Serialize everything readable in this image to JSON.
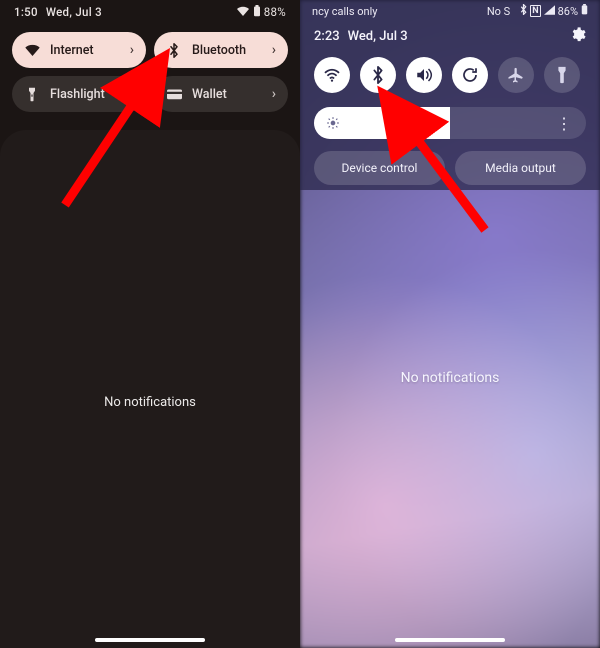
{
  "left": {
    "status": {
      "time": "1:50",
      "date": "Wed, Jul 3",
      "battery_percent": "88%"
    },
    "tiles": [
      {
        "id": "internet",
        "label": "Internet",
        "state": "on",
        "icon": "wifi-icon"
      },
      {
        "id": "bluetooth",
        "label": "Bluetooth",
        "state": "on",
        "icon": "bluetooth-icon"
      },
      {
        "id": "flashlight",
        "label": "Flashlight",
        "state": "off",
        "icon": "flashlight-icon"
      },
      {
        "id": "wallet",
        "label": "Wallet",
        "state": "off",
        "icon": "wallet-icon"
      }
    ],
    "no_notifications": "No notifications"
  },
  "right": {
    "status": {
      "left_text": "ncy calls only",
      "carrier_right_partial": "No S",
      "battery_percent": "86%"
    },
    "header": {
      "time": "2:23",
      "date": "Wed, Jul 3"
    },
    "toggles": [
      {
        "id": "wifi",
        "state": "on",
        "icon": "wifi-icon"
      },
      {
        "id": "bluetooth",
        "state": "on",
        "icon": "bluetooth-icon"
      },
      {
        "id": "sound",
        "state": "on",
        "icon": "sound-icon"
      },
      {
        "id": "rotate",
        "state": "on",
        "icon": "rotate-icon"
      },
      {
        "id": "airplane",
        "state": "off",
        "icon": "airplane-icon"
      },
      {
        "id": "flashlight",
        "state": "off",
        "icon": "flashlight-icon"
      }
    ],
    "brightness": {
      "percent": 50
    },
    "buttons": {
      "device_control": "Device control",
      "media_output": "Media output"
    },
    "no_notifications": "No notifications"
  },
  "annotation": {
    "arrow_color": "#ff0000"
  }
}
